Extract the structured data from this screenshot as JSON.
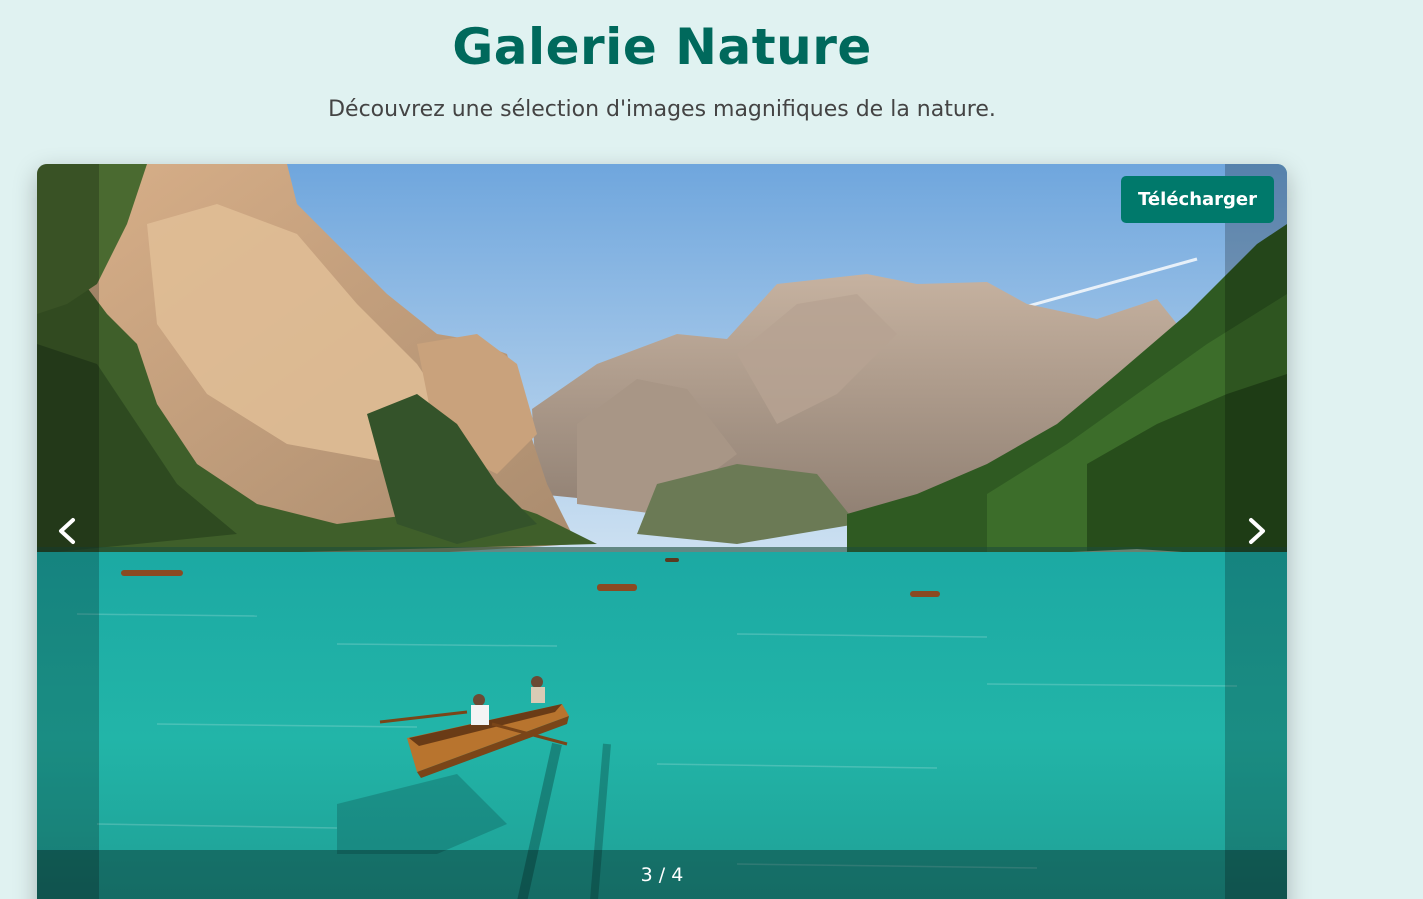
{
  "header": {
    "title": "Galerie Nature",
    "subtitle": "Découvrez une sélection d'images magnifiques de la nature."
  },
  "gallery": {
    "download_label": "Télécharger",
    "counter": "3 / 4",
    "current_index": 3,
    "total": 4,
    "image_subject": "mountain lake with rowing boats"
  },
  "colors": {
    "background": "#e0f2f1",
    "title": "#00695c",
    "button": "#00796b",
    "water": "#1fb3a6"
  },
  "icons": {
    "previous": "chevron-left-icon",
    "next": "chevron-right-icon"
  }
}
